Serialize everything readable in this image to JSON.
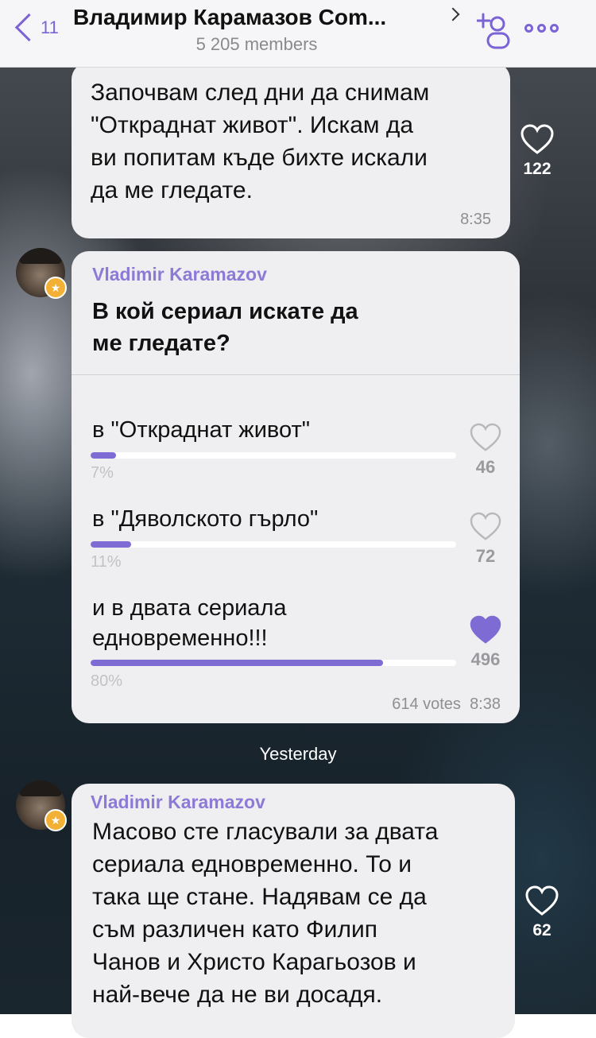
{
  "header": {
    "back_count": "11",
    "title": "Владимир Карамазов Com...",
    "subtitle": "5 205 members",
    "icons": {
      "back": "back-chevron-icon",
      "add": "add-participant-icon",
      "more": "more-icon"
    },
    "accent": "#7b63d6"
  },
  "messages": [
    {
      "text_lines": [
        "Започвам след дни да снимам",
        "\"Откраднат живот\". Искам да",
        "ви попитам къде бихте искали",
        "да ме гледате."
      ],
      "time": "8:35",
      "likes": "122"
    }
  ],
  "poll": {
    "sender": "Vladimir Karamazov",
    "question_lines": [
      "В кой сериал искате да",
      "ме гледате?"
    ],
    "options": [
      {
        "label_lines": [
          "в \"Откраднат живот\""
        ],
        "percent_text": "7%",
        "fraction": 0.07,
        "likes": "46",
        "liked": false
      },
      {
        "label_lines": [
          "в \"Дяволското гърло\""
        ],
        "percent_text": "11%",
        "fraction": 0.11,
        "likes": "72",
        "liked": false
      },
      {
        "label_lines": [
          "и в двата сериала",
          "едновременно!!!"
        ],
        "percent_text": "80%",
        "fraction": 0.8,
        "likes": "496",
        "liked": true
      }
    ],
    "votes": "614 votes",
    "time": "8:38"
  },
  "date_separator": "Yesterday",
  "last_message": {
    "sender": "Vladimir Karamazov",
    "text_lines": [
      "Масово сте гласували за двата",
      "сериала едновременно. То и",
      "така ще стане. Надявам се да",
      "съм различен като Филип",
      "Чанов и Христо Карагьозов и",
      "най-вече да не ви досадя."
    ],
    "likes": "62"
  },
  "colors": {
    "bubble": "#efeff1",
    "poll_fill": "#7f6bd4",
    "sender": "#8d7ad6"
  }
}
